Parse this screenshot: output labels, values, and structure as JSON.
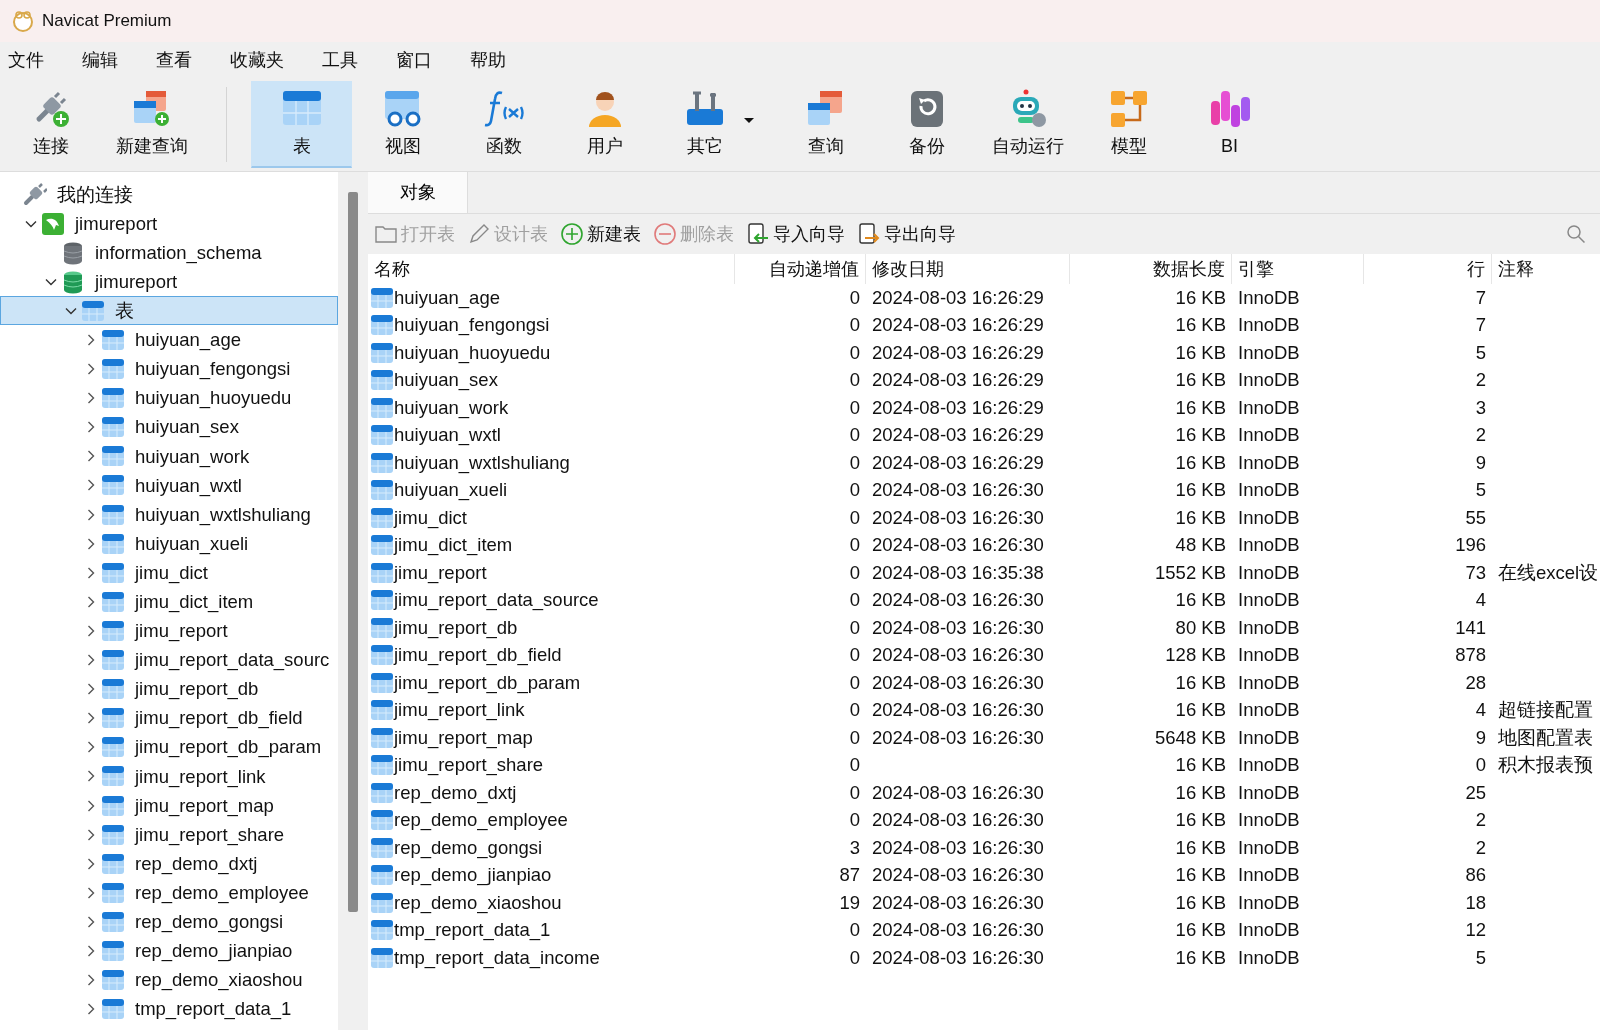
{
  "window": {
    "title": "Navicat Premium"
  },
  "menu": [
    "文件",
    "编辑",
    "查看",
    "收藏夹",
    "工具",
    "窗口",
    "帮助"
  ],
  "toolbar": [
    {
      "label": "连接",
      "separator_after": false,
      "selected": false,
      "has_dropdown": false
    },
    {
      "label": "新建查询",
      "separator_after": true,
      "selected": false,
      "has_dropdown": false
    },
    {
      "label": "表",
      "separator_after": false,
      "selected": true,
      "has_dropdown": false
    },
    {
      "label": "视图",
      "separator_after": false,
      "selected": false,
      "has_dropdown": false
    },
    {
      "label": "函数",
      "separator_after": false,
      "selected": false,
      "has_dropdown": false
    },
    {
      "label": "用户",
      "separator_after": false,
      "selected": false,
      "has_dropdown": false
    },
    {
      "label": "其它",
      "separator_after": false,
      "selected": false,
      "has_dropdown": true
    },
    {
      "label": "查询",
      "separator_after": false,
      "selected": false,
      "has_dropdown": false
    },
    {
      "label": "备份",
      "separator_after": false,
      "selected": false,
      "has_dropdown": false
    },
    {
      "label": "自动运行",
      "separator_after": false,
      "selected": false,
      "has_dropdown": false
    },
    {
      "label": "模型",
      "separator_after": false,
      "selected": false,
      "has_dropdown": false
    },
    {
      "label": "BI",
      "separator_after": false,
      "selected": false,
      "has_dropdown": false
    }
  ],
  "sidebar": {
    "tree": [
      {
        "label": "我的连接",
        "kind": "group",
        "children": [
          {
            "label": "jimureport",
            "kind": "connection",
            "expanded": true,
            "selected": false,
            "children": [
              {
                "label": "information_schema",
                "kind": "database_closed",
                "selected": false
              },
              {
                "label": "jimureport",
                "kind": "database",
                "expanded": true,
                "selected": false,
                "children": [
                  {
                    "label": "表",
                    "kind": "folder",
                    "expanded": true,
                    "selected": true,
                    "children": [
                      {
                        "label": "huiyuan_age",
                        "kind": "table",
                        "expanded": false,
                        "selected": false
                      },
                      {
                        "label": "huiyuan_fengongsi",
                        "kind": "table",
                        "expanded": false,
                        "selected": false
                      },
                      {
                        "label": "huiyuan_huoyuedu",
                        "kind": "table",
                        "expanded": false,
                        "selected": false
                      },
                      {
                        "label": "huiyuan_sex",
                        "kind": "table",
                        "expanded": false,
                        "selected": false
                      },
                      {
                        "label": "huiyuan_work",
                        "kind": "table",
                        "expanded": false,
                        "selected": false
                      },
                      {
                        "label": "huiyuan_wxtl",
                        "kind": "table",
                        "expanded": false,
                        "selected": false
                      },
                      {
                        "label": "huiyuan_wxtlshuliang",
                        "kind": "table",
                        "expanded": false,
                        "selected": false
                      },
                      {
                        "label": "huiyuan_xueli",
                        "kind": "table",
                        "expanded": false,
                        "selected": false
                      },
                      {
                        "label": "jimu_dict",
                        "kind": "table",
                        "expanded": false,
                        "selected": false
                      },
                      {
                        "label": "jimu_dict_item",
                        "kind": "table",
                        "expanded": false,
                        "selected": false
                      },
                      {
                        "label": "jimu_report",
                        "kind": "table",
                        "expanded": false,
                        "selected": false
                      },
                      {
                        "label": "jimu_report_data_sourc",
                        "kind": "table",
                        "expanded": false,
                        "selected": false
                      },
                      {
                        "label": "jimu_report_db",
                        "kind": "table",
                        "expanded": false,
                        "selected": false
                      },
                      {
                        "label": "jimu_report_db_field",
                        "kind": "table",
                        "expanded": false,
                        "selected": false
                      },
                      {
                        "label": "jimu_report_db_param",
                        "kind": "table",
                        "expanded": false,
                        "selected": false
                      },
                      {
                        "label": "jimu_report_link",
                        "kind": "table",
                        "expanded": false,
                        "selected": false
                      },
                      {
                        "label": "jimu_report_map",
                        "kind": "table",
                        "expanded": false,
                        "selected": false
                      },
                      {
                        "label": "jimu_report_share",
                        "kind": "table",
                        "expanded": false,
                        "selected": false
                      },
                      {
                        "label": "rep_demo_dxtj",
                        "kind": "table",
                        "expanded": false,
                        "selected": false
                      },
                      {
                        "label": "rep_demo_employee",
                        "kind": "table",
                        "expanded": false,
                        "selected": false
                      },
                      {
                        "label": "rep_demo_gongsi",
                        "kind": "table",
                        "expanded": false,
                        "selected": false
                      },
                      {
                        "label": "rep_demo_jianpiao",
                        "kind": "table",
                        "expanded": false,
                        "selected": false
                      },
                      {
                        "label": "rep_demo_xiaoshou",
                        "kind": "table",
                        "expanded": false,
                        "selected": false
                      },
                      {
                        "label": "tmp_report_data_1",
                        "kind": "table",
                        "expanded": false,
                        "selected": false
                      }
                    ]
                  }
                ]
              }
            ]
          }
        ]
      }
    ]
  },
  "tabs": [
    {
      "label": "对象",
      "selected": true
    }
  ],
  "object_toolbar": [
    {
      "label": "打开表",
      "disabled": true
    },
    {
      "label": "设计表",
      "disabled": true
    },
    {
      "label": "新建表",
      "disabled": false
    },
    {
      "label": "删除表",
      "disabled": true
    },
    {
      "label": "导入向导",
      "disabled": false
    },
    {
      "label": "导出向导",
      "disabled": false
    }
  ],
  "table": {
    "columns": [
      "名称",
      "自动递增值",
      "修改日期",
      "数据长度",
      "引擎",
      "行",
      "注释"
    ],
    "rows": [
      {
        "name": "huiyuan_age",
        "auto_increment": "0",
        "modified": "2024-08-03 16:26:29",
        "data_length": "16 KB",
        "engine": "InnoDB",
        "rows": "7"
      },
      {
        "name": "huiyuan_fengongsi",
        "auto_increment": "0",
        "modified": "2024-08-03 16:26:29",
        "data_length": "16 KB",
        "engine": "InnoDB",
        "rows": "7"
      },
      {
        "name": "huiyuan_huoyuedu",
        "auto_increment": "0",
        "modified": "2024-08-03 16:26:29",
        "data_length": "16 KB",
        "engine": "InnoDB",
        "rows": "5"
      },
      {
        "name": "huiyuan_sex",
        "auto_increment": "0",
        "modified": "2024-08-03 16:26:29",
        "data_length": "16 KB",
        "engine": "InnoDB",
        "rows": "2"
      },
      {
        "name": "huiyuan_work",
        "auto_increment": "0",
        "modified": "2024-08-03 16:26:29",
        "data_length": "16 KB",
        "engine": "InnoDB",
        "rows": "3"
      },
      {
        "name": "huiyuan_wxtl",
        "auto_increment": "0",
        "modified": "2024-08-03 16:26:29",
        "data_length": "16 KB",
        "engine": "InnoDB",
        "rows": "2"
      },
      {
        "name": "huiyuan_wxtlshuliang",
        "auto_increment": "0",
        "modified": "2024-08-03 16:26:29",
        "data_length": "16 KB",
        "engine": "InnoDB",
        "rows": "9"
      },
      {
        "name": "huiyuan_xueli",
        "auto_increment": "0",
        "modified": "2024-08-03 16:26:30",
        "data_length": "16 KB",
        "engine": "InnoDB",
        "rows": "5"
      },
      {
        "name": "jimu_dict",
        "auto_increment": "0",
        "modified": "2024-08-03 16:26:30",
        "data_length": "16 KB",
        "engine": "InnoDB",
        "rows": "55"
      },
      {
        "name": "jimu_dict_item",
        "auto_increment": "0",
        "modified": "2024-08-03 16:26:30",
        "data_length": "48 KB",
        "engine": "InnoDB",
        "rows": "196"
      },
      {
        "name": "jimu_report",
        "auto_increment": "0",
        "modified": "2024-08-03 16:35:38",
        "data_length": "1552 KB",
        "engine": "InnoDB",
        "rows": "73",
        "comment": "在线excel设"
      },
      {
        "name": "jimu_report_data_source",
        "auto_increment": "0",
        "modified": "2024-08-03 16:26:30",
        "data_length": "16 KB",
        "engine": "InnoDB",
        "rows": "4"
      },
      {
        "name": "jimu_report_db",
        "auto_increment": "0",
        "modified": "2024-08-03 16:26:30",
        "data_length": "80 KB",
        "engine": "InnoDB",
        "rows": "141"
      },
      {
        "name": "jimu_report_db_field",
        "auto_increment": "0",
        "modified": "2024-08-03 16:26:30",
        "data_length": "128 KB",
        "engine": "InnoDB",
        "rows": "878"
      },
      {
        "name": "jimu_report_db_param",
        "auto_increment": "0",
        "modified": "2024-08-03 16:26:30",
        "data_length": "16 KB",
        "engine": "InnoDB",
        "rows": "28"
      },
      {
        "name": "jimu_report_link",
        "auto_increment": "0",
        "modified": "2024-08-03 16:26:30",
        "data_length": "16 KB",
        "engine": "InnoDB",
        "rows": "4",
        "comment": "超链接配置"
      },
      {
        "name": "jimu_report_map",
        "auto_increment": "0",
        "modified": "2024-08-03 16:26:30",
        "data_length": "5648 KB",
        "engine": "InnoDB",
        "rows": "9",
        "comment": "地图配置表"
      },
      {
        "name": "jimu_report_share",
        "auto_increment": "0",
        "data_length": "16 KB",
        "engine": "InnoDB",
        "rows": "0",
        "comment": "积木报表预"
      },
      {
        "name": "rep_demo_dxtj",
        "auto_increment": "0",
        "modified": "2024-08-03 16:26:30",
        "data_length": "16 KB",
        "engine": "InnoDB",
        "rows": "25"
      },
      {
        "name": "rep_demo_employee",
        "auto_increment": "0",
        "modified": "2024-08-03 16:26:30",
        "data_length": "16 KB",
        "engine": "InnoDB",
        "rows": "2"
      },
      {
        "name": "rep_demo_gongsi",
        "auto_increment": "3",
        "modified": "2024-08-03 16:26:30",
        "data_length": "16 KB",
        "engine": "InnoDB",
        "rows": "2"
      },
      {
        "name": "rep_demo_jianpiao",
        "auto_increment": "87",
        "modified": "2024-08-03 16:26:30",
        "data_length": "16 KB",
        "engine": "InnoDB",
        "rows": "86"
      },
      {
        "name": "rep_demo_xiaoshou",
        "auto_increment": "19",
        "modified": "2024-08-03 16:26:30",
        "data_length": "16 KB",
        "engine": "InnoDB",
        "rows": "18"
      },
      {
        "name": "tmp_report_data_1",
        "auto_increment": "0",
        "modified": "2024-08-03 16:26:30",
        "data_length": "16 KB",
        "engine": "InnoDB",
        "rows": "12"
      },
      {
        "name": "tmp_report_data_income",
        "auto_increment": "0",
        "modified": "2024-08-03 16:26:30",
        "data_length": "16 KB",
        "engine": "InnoDB",
        "rows": "5"
      }
    ]
  }
}
